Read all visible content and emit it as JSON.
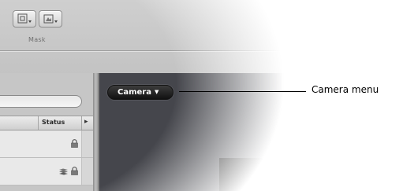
{
  "toolbar": {
    "mask_label": "Mask",
    "buttons": [
      {
        "icon": "mask-rectangle-icon"
      },
      {
        "icon": "mask-shape-icon"
      }
    ]
  },
  "layers_list": {
    "columns": [
      {
        "label": "Status"
      }
    ],
    "rows": [
      {
        "status_icons": [
          "lock-icon"
        ]
      },
      {
        "status_icons": [
          "layers-icon",
          "lock-icon"
        ]
      }
    ]
  },
  "canvas": {
    "camera_menu_label": "Camera",
    "camera_menu_arrow": "▼"
  },
  "callout": {
    "label": "Camera menu"
  }
}
